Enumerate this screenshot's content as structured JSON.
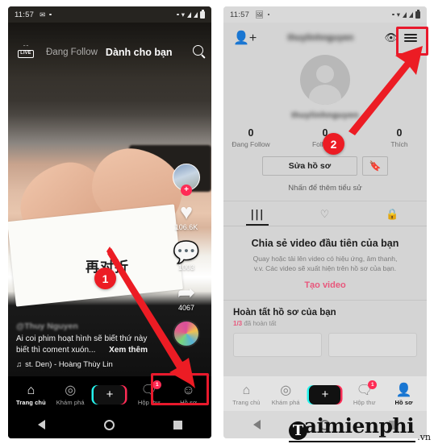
{
  "left_phone": {
    "status_bar": {
      "time": "11:57",
      "icons": [
        "mail-icon",
        "dot-icon",
        "dot-icon",
        "signal-icon",
        "wifi-icon",
        "cellular-icon",
        "cellular-icon",
        "battery-icon"
      ]
    },
    "feed_nav": {
      "live_label": "LIVE",
      "tab_following": "Đang Follow",
      "tab_foryou": "Dành cho bạn",
      "search_icon": "search-icon"
    },
    "video": {
      "overlay_text": "再对折",
      "author": "@Thuy Nguyen",
      "caption_line1": "Ai coi phim hoạt hình sẽ biết thứ này",
      "caption_line2": "biết thì coment xuón...",
      "see_more": "Xem thêm",
      "music": "st. Den) - Hoàng Thùy Lin",
      "music_icon": "music-note-icon"
    },
    "rail": {
      "follow_plus": "+",
      "like_icon": "heart-icon",
      "like_count": "106.6K",
      "comment_icon": "comment-icon",
      "comment_count": "1003",
      "share_icon": "share-icon",
      "share_count": "4067",
      "disc_icon": "music-disc-icon"
    },
    "bottom_nav": [
      {
        "icon": "home-icon",
        "label": "Trang chủ",
        "active": true,
        "badge": ""
      },
      {
        "icon": "compass-icon",
        "label": "Khám phá",
        "active": false,
        "badge": ""
      },
      {
        "icon": "plus-icon",
        "label": "",
        "active": false,
        "badge": ""
      },
      {
        "icon": "inbox-icon",
        "label": "Hộp thư",
        "active": false,
        "badge": "1"
      },
      {
        "icon": "profile-icon",
        "label": "Hồ sơ",
        "active": false,
        "badge": ""
      }
    ],
    "system_bar": {
      "back": "back-icon",
      "home": "home-circle-icon",
      "recent": "recents-icon"
    }
  },
  "right_phone": {
    "status_bar": {
      "time": "11:57"
    },
    "header": {
      "add_friend_icon": "add-friend-icon",
      "username": "thuylinhnguyen",
      "eye_icon": "eye-icon",
      "menu_icon": "hamburger-menu-icon"
    },
    "profile": {
      "avatar": "default-avatar-icon",
      "handle": "thuylinhnguyen",
      "stats": [
        {
          "value": "0",
          "label": "Đang Follow"
        },
        {
          "value": "0",
          "label": "Follower"
        },
        {
          "value": "0",
          "label": "Thích"
        }
      ],
      "edit_button": "Sửa hồ sơ",
      "bookmark_icon": "bookmark-icon",
      "bio_hint": "Nhấn để thêm tiểu sử"
    },
    "tabs": [
      {
        "icon": "grid-icon",
        "active": true
      },
      {
        "icon": "heart-slash-icon",
        "active": false
      },
      {
        "icon": "lock-icon",
        "active": false
      }
    ],
    "empty_state": {
      "title": "Chia sẻ video đầu tiên của bạn",
      "subtitle_line1": "Quay hoặc tải lên video có hiệu ứng, âm thanh,",
      "subtitle_line2": "v.v. Các video sẽ xuất hiện trên hồ sơ của bạn.",
      "cta": "Tạo video"
    },
    "complete_profile": {
      "title": "Hoàn tất hồ sơ của bạn",
      "progress": "1/3",
      "progress_suffix": "đã hoàn tất"
    },
    "bottom_nav": [
      {
        "icon": "home-icon",
        "label": "Trang chủ",
        "active": false,
        "badge": ""
      },
      {
        "icon": "compass-icon",
        "label": "Khám phá",
        "active": false,
        "badge": ""
      },
      {
        "icon": "plus-icon",
        "label": "",
        "active": false,
        "badge": ""
      },
      {
        "icon": "inbox-icon",
        "label": "Hộp thư",
        "active": false,
        "badge": "1"
      },
      {
        "icon": "profile-icon",
        "label": "Hồ sơ",
        "active": true,
        "badge": ""
      }
    ]
  },
  "annotations": {
    "step1": "1",
    "step2": "2"
  },
  "watermark": {
    "circle_letter": "T",
    "name": "aimienphi",
    "tld": ".vn"
  },
  "colors": {
    "accent_red": "#ec1c24",
    "tiktok_pink": "#fe2c55",
    "tiktok_cyan": "#25f4ee",
    "cta_pink": "#e8577c"
  }
}
